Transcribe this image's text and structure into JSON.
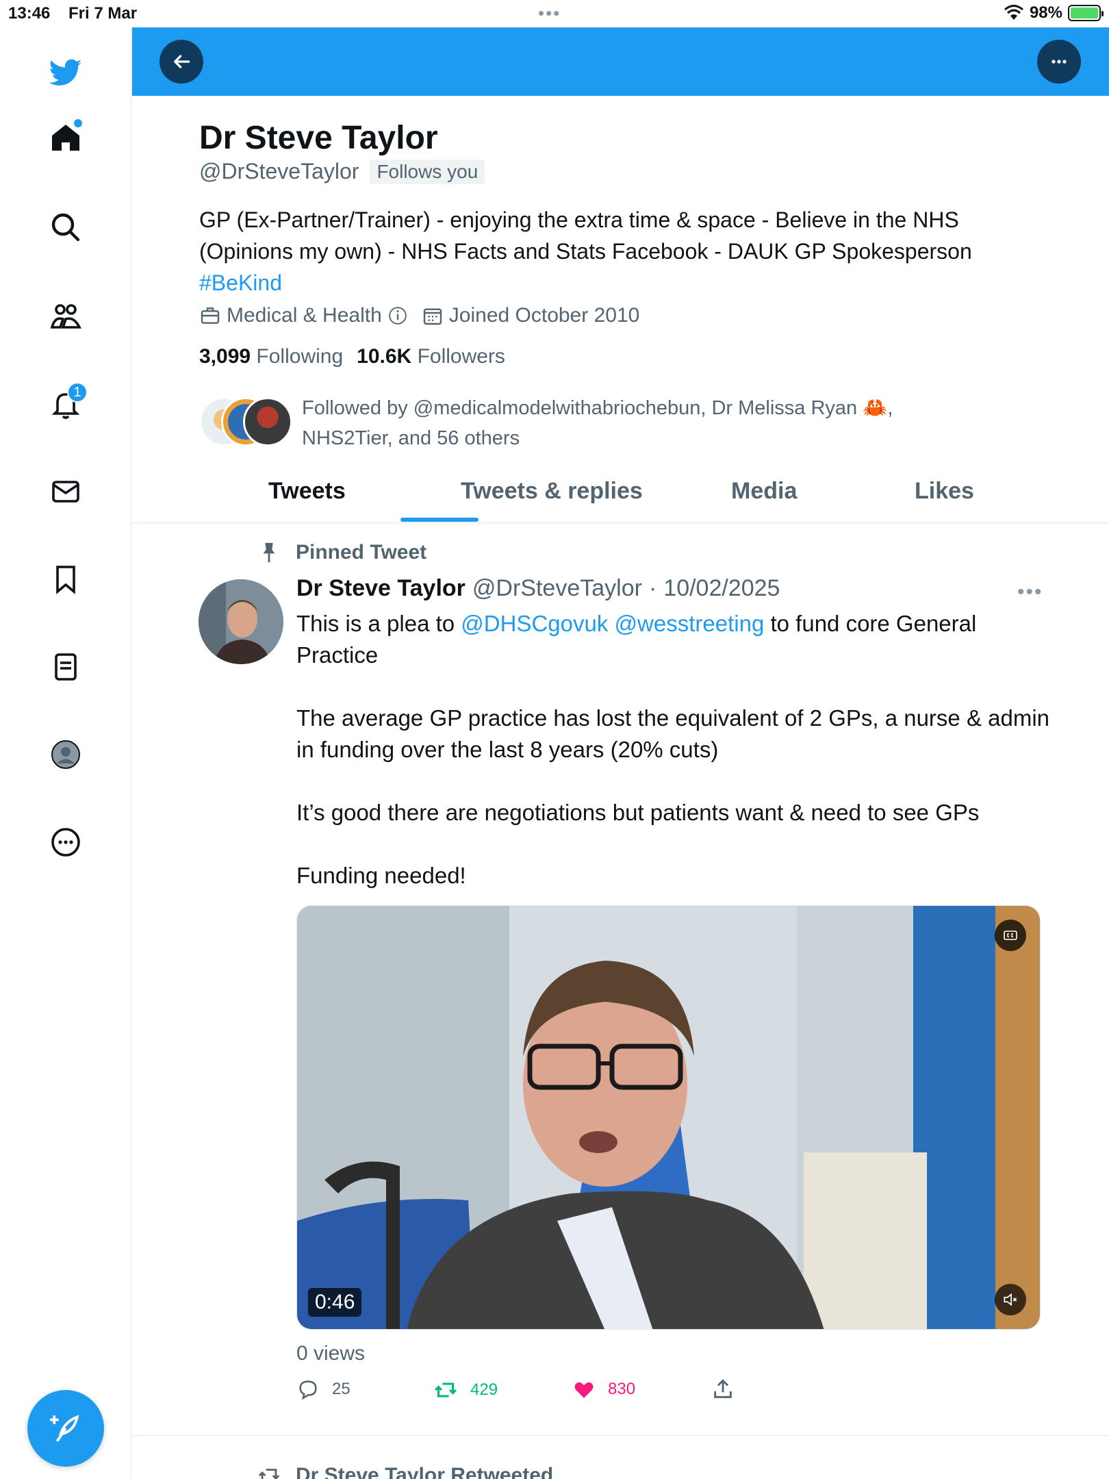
{
  "status_bar": {
    "time": "13:46",
    "date": "Fri 7 Mar",
    "dots": "•••",
    "battery": "98%"
  },
  "nav": {
    "notifications_count": "1"
  },
  "profile": {
    "name": "Dr Steve Taylor",
    "handle": "@DrSteveTaylor",
    "follows_you": "Follows you",
    "bio_line1": "GP (Ex-Partner/Trainer) - enjoying the extra time & space - Believe in the NHS",
    "bio_line2": "(Opinions my own) - NHS Facts and Stats Facebook - DAUK GP Spokesperson",
    "bio_hashtag": "#BeKind",
    "category": "Medical & Health",
    "joined": "Joined October 2010",
    "following_count": "3,099",
    "following_label": "Following",
    "followers_count": "10.6K",
    "followers_label": "Followers",
    "followed_by_line1": "Followed by @medicalmodelwithabriochebun, Dr Melissa Ryan 🦀,",
    "followed_by_line2": "NHS2Tier, and 56 others"
  },
  "tabs": [
    {
      "label": "Tweets",
      "active": true
    },
    {
      "label": "Tweets & replies",
      "active": false
    },
    {
      "label": "Media",
      "active": false
    },
    {
      "label": "Likes",
      "active": false
    }
  ],
  "tweet": {
    "pinned_label": "Pinned Tweet",
    "author_name": "Dr Steve Taylor",
    "author_handle": "@DrSteveTaylor",
    "separator": "·",
    "date": "10/02/2025",
    "more": "•••",
    "text_part1": "This is a plea to",
    "mention1": "@DHSCgovuk",
    "mention2": "@wesstreeting",
    "text_part2": "to fund core General Practice",
    "paragraph2": "The average GP practice has lost the equivalent of 2 GPs, a nurse & admin in funding over the last 8 years (20% cuts)",
    "paragraph3": "It’s good there are negotiations but patients want & need to see GPs",
    "paragraph4": "Funding needed!",
    "video_duration": "0:46",
    "views": "0 views",
    "replies": "25",
    "retweets": "429",
    "likes": "830"
  },
  "next_item": {
    "label": "Dr Steve Taylor Retweeted"
  },
  "colors": {
    "brand_blue": "#1d9bf0",
    "retweet_green": "#00ba7c",
    "like_pink": "#f91880",
    "text_secondary": "#536471"
  }
}
